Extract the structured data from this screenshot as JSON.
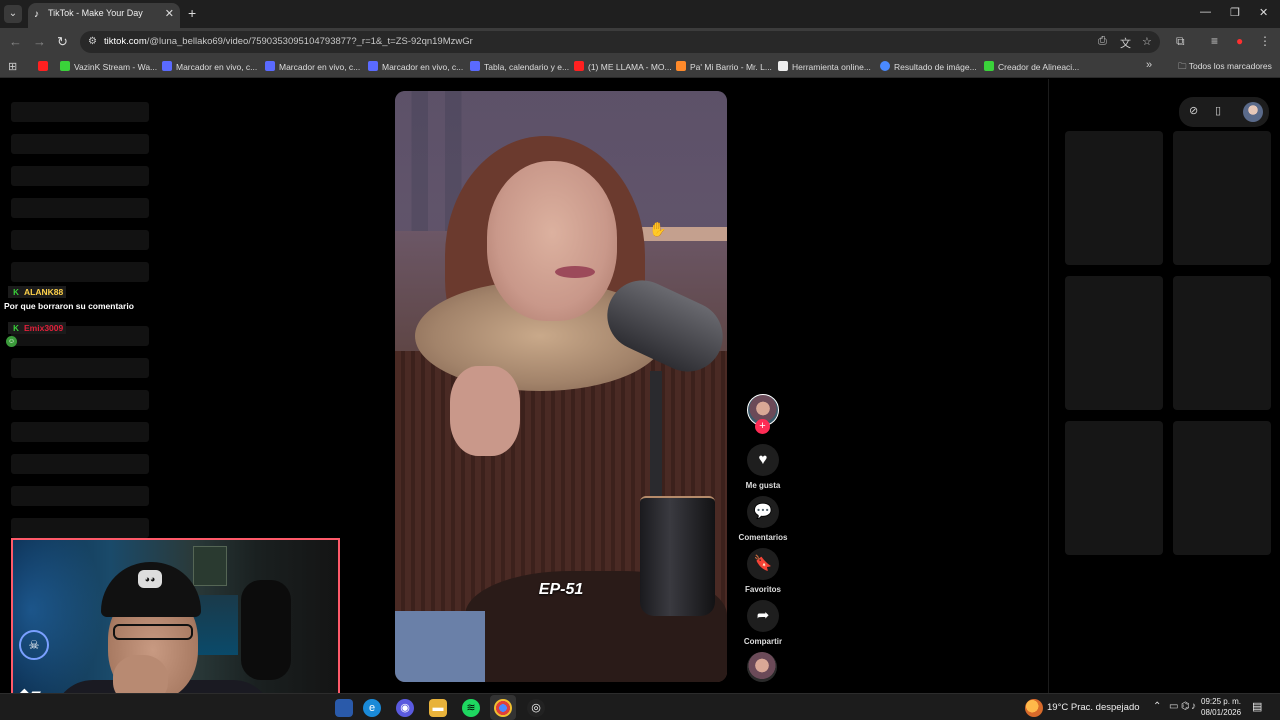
{
  "browser": {
    "tab_title": "TikTok - Make Your Day",
    "url_host": "tiktok.com",
    "url_path": "/@luna_bellako69/video/7590353095104793877?_r=1&_t=ZS-92qn19MzwGr",
    "bookmarks": [
      {
        "label": "VazinK Stream - Wa...",
        "color": "#3ad23a"
      },
      {
        "label": "Marcador en vivo, c...",
        "color": "#5a6aff"
      },
      {
        "label": "Marcador en vivo, c...",
        "color": "#5a6aff"
      },
      {
        "label": "Marcador en vivo, c...",
        "color": "#5a6aff"
      },
      {
        "label": "Tabla, calendario y e...",
        "color": "#5a6aff"
      },
      {
        "label": "(1) ME LLAMA - MO...",
        "color": "#ff2020"
      },
      {
        "label": "Pa' Mi Barrio - Mr. L...",
        "color": "#ff8a2a"
      },
      {
        "label": "Herramienta online...",
        "color": "#eeeeee"
      },
      {
        "label": "Resultado de imáge...",
        "color": "#4a8aff"
      },
      {
        "label": "Creador de Alineaci...",
        "color": "#3ad23a"
      }
    ],
    "all_bookmarks_label": "Todos los marcadores"
  },
  "video": {
    "caption": "EP-51"
  },
  "actions": {
    "like_label": "Me gusta",
    "comments_label": "Comentarios",
    "favorites_label": "Favoritos",
    "share_label": "Compartir"
  },
  "chat": {
    "user1": "ALANK88",
    "message1": "Por que borraron su comentario",
    "user2": "Emix3009"
  },
  "taskbar": {
    "weather": "19°C  Prac. despejado",
    "time": "09:25 p. m.",
    "date": "08/01/2026"
  }
}
